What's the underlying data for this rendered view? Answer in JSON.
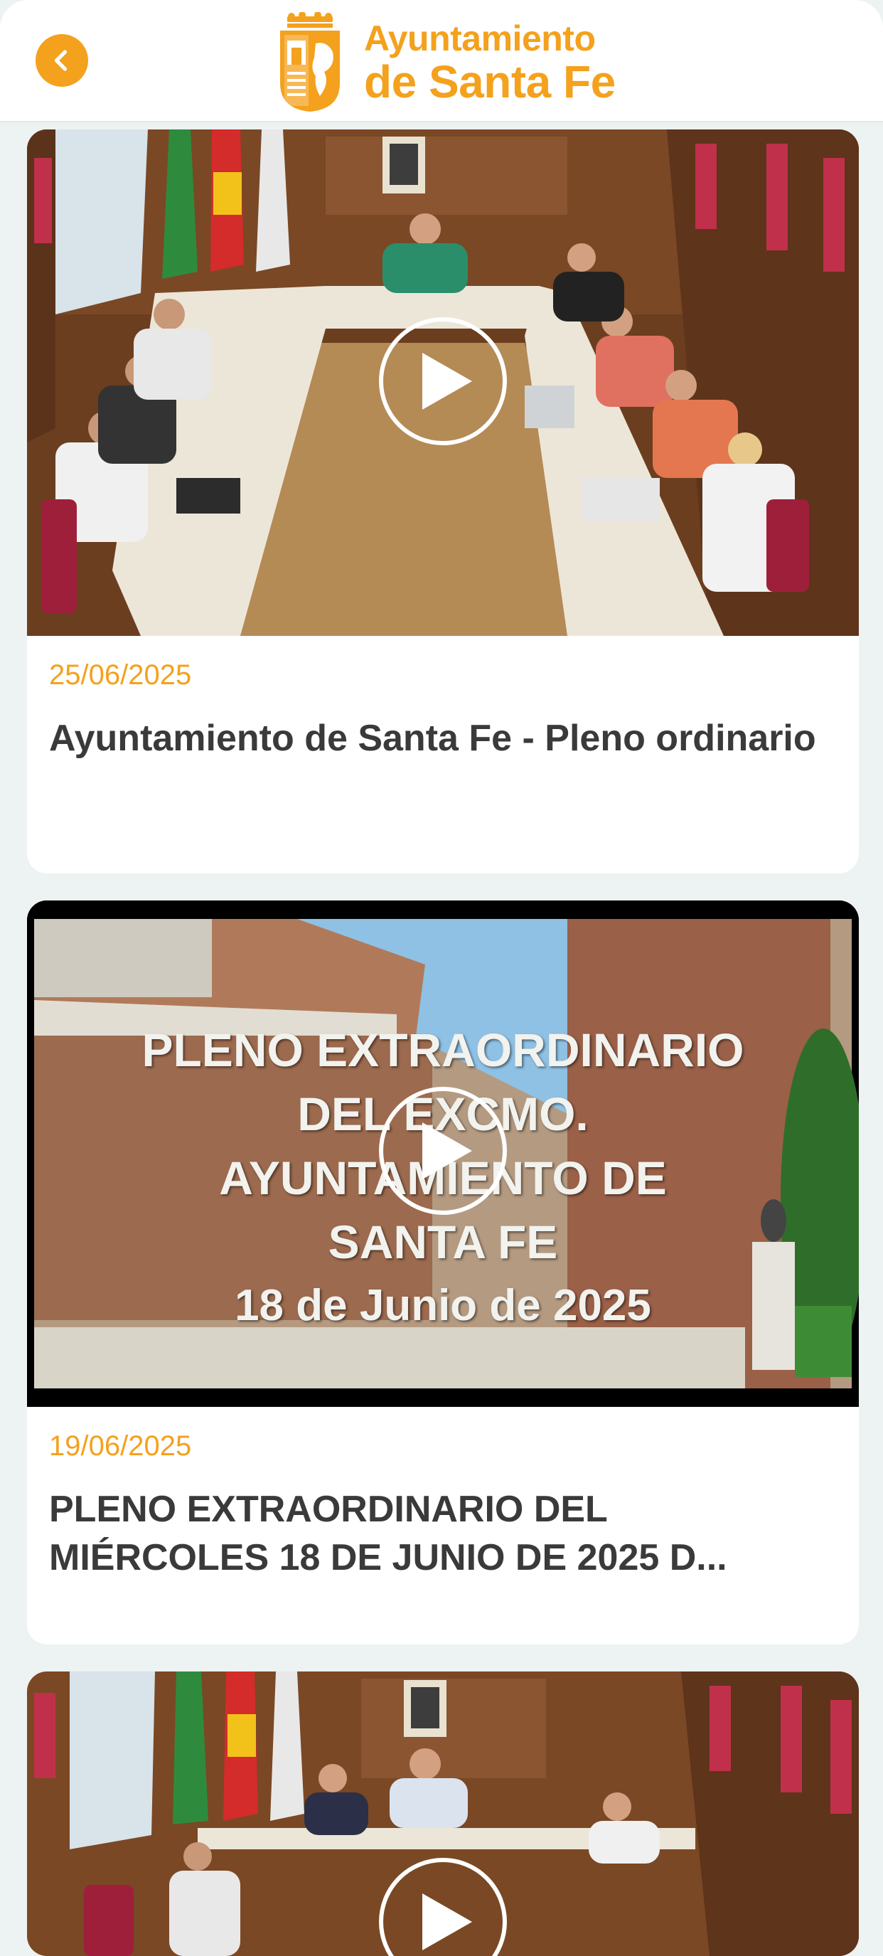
{
  "header": {
    "back_icon": "chevron-left-icon",
    "logo_line1": "Ayuntamiento",
    "logo_line2": "de Santa Fe",
    "accent_color": "#f4a11d"
  },
  "videos": [
    {
      "date": "25/06/2025",
      "title": "Ayuntamiento de Santa Fe - Pleno ordinario",
      "thumbnail": "council-chamber-meeting"
    },
    {
      "date": "19/06/2025",
      "title_line1": "PLENO EXTRAORDINARIO DEL",
      "title_line2": "MIÉRCOLES 18 DE JUNIO DE 2025 D...",
      "thumbnail": "building-exterior-title-card",
      "overlay_text": [
        "PLENO EXTRAORDINARIO",
        "DEL EXCMO.",
        "AYUNTAMIENTO DE",
        "SANTA FE",
        "18 de Junio de 2025"
      ]
    },
    {
      "thumbnail": "council-chamber-meeting"
    }
  ]
}
